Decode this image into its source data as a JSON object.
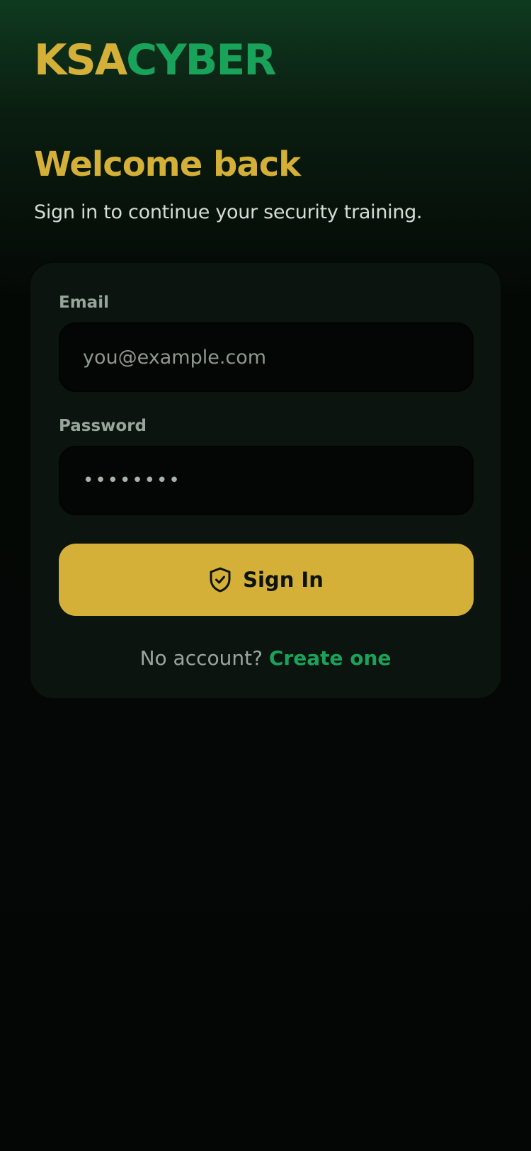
{
  "brand": {
    "part_a": "KSA",
    "part_b": "CYBER"
  },
  "welcome": {
    "title": "Welcome back",
    "subtitle": "Sign in to continue your security training."
  },
  "form": {
    "email_label": "Email",
    "email_placeholder": "you@example.com",
    "email_value": "",
    "password_label": "Password",
    "password_value": "••••••••",
    "submit_label": "Sign In",
    "submit_icon": "shield-check-icon"
  },
  "footer": {
    "prompt": "No account?",
    "link_label": "Create one"
  },
  "colors": {
    "accent_gold": "#d4b038",
    "accent_green": "#19a35a",
    "background": "#040605",
    "card": "#0b140f"
  }
}
